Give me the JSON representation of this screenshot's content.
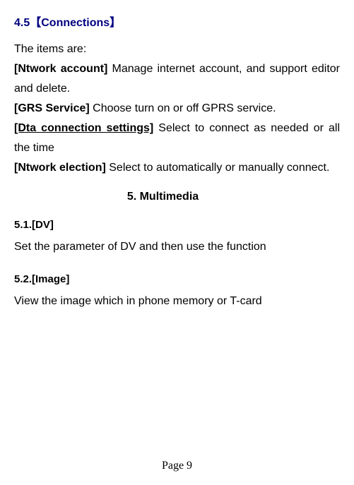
{
  "section45": {
    "heading": "4.5【Connections】",
    "intro": "The items are:",
    "items": [
      {
        "label": "[Ntwork account]",
        "text": " Manage internet account, and support editor and delete."
      },
      {
        "label": "[GRS Service]",
        "text": " Choose turn on or off GPRS service."
      },
      {
        "label": "[Dta connection settings]",
        "text": " Select to connect as needed or all the time",
        "labelUnderlined": true
      },
      {
        "label": "[Ntwork election]",
        "text": " Select to automatically or manually connect."
      }
    ]
  },
  "chapter5": {
    "heading": "5.      Multimedia"
  },
  "section51": {
    "heading": "5.1.[DV]",
    "body": "Set the parameter of DV and then use the function"
  },
  "section52": {
    "heading": "5.2.[Image]",
    "body": "View the image which in phone memory or T-card"
  },
  "footer": {
    "pageLabel": "Page 9"
  }
}
